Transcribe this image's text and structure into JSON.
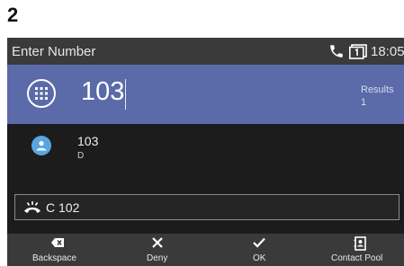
{
  "step_label": "2",
  "status_bar": {
    "title": "Enter Number",
    "time": "18:05"
  },
  "dial": {
    "number": "103",
    "results_label": "Results",
    "results_count": "1"
  },
  "results": [
    {
      "number": "103",
      "sub": "D"
    }
  ],
  "held_call": {
    "label": "C 102"
  },
  "softkeys": [
    {
      "label": "Backspace",
      "icon": "backspace-icon"
    },
    {
      "label": "Deny",
      "icon": "close-icon"
    },
    {
      "label": "OK",
      "icon": "check-icon"
    },
    {
      "label": "Contact Pool",
      "icon": "contact-book-icon"
    }
  ],
  "colors": {
    "header_bar": "#3a3a3a",
    "dial_bar": "#5b6aa8",
    "screen_bg": "#1c1c1c",
    "avatar": "#58a6e0"
  }
}
